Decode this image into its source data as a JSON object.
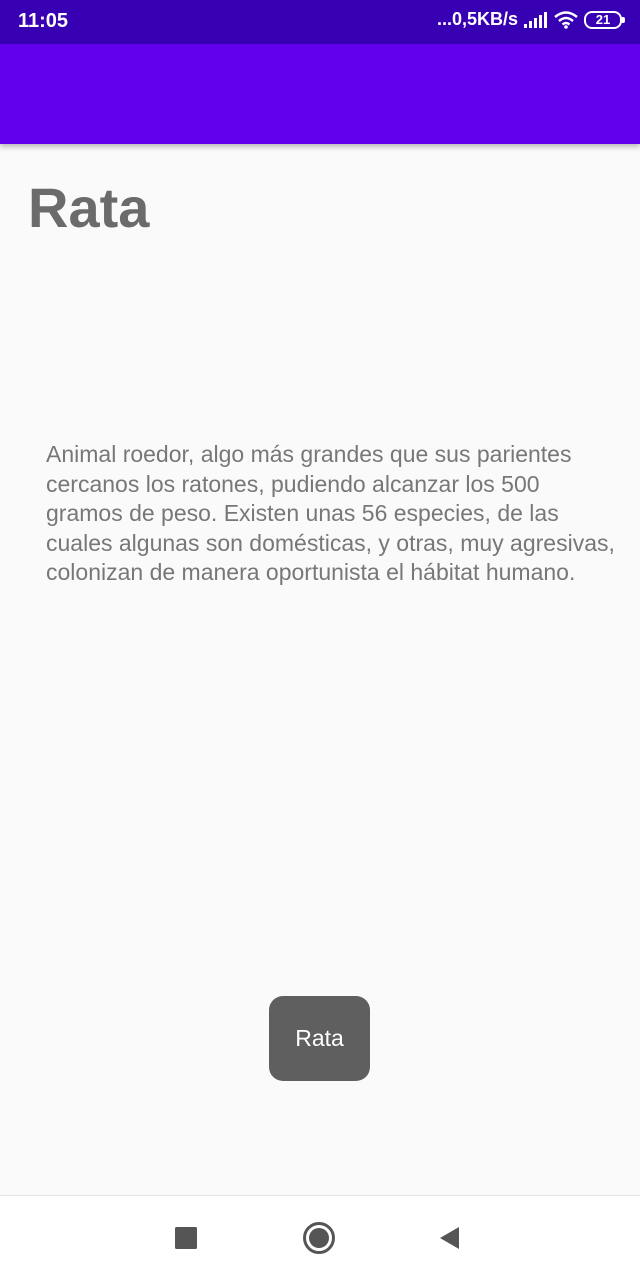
{
  "status_bar": {
    "time": "11:05",
    "network_speed": "...0,5KB/s",
    "battery_level": "21",
    "icons": [
      "signal-icon",
      "wifi-icon",
      "battery-icon"
    ]
  },
  "colors": {
    "status_bar": "#3700b3",
    "app_bar": "#6200ee",
    "background": "#fafafa",
    "title_text": "#6b6b6b",
    "body_text": "#777777",
    "toast": "#5f5f5f"
  },
  "main": {
    "title": "Rata",
    "description": "Animal roedor, algo más grandes que sus parientes cercanos los ratones, pudiendo alcanzar los 500 gramos de peso. Existen unas 56 especies, de las cuales algunas son domésticas, y otras, muy agresivas, colonizan de manera oportunista el hábitat humano."
  },
  "toast": {
    "text": "Rata"
  },
  "nav_bar": {
    "icons": [
      "recents-square-icon",
      "home-circle-icon",
      "back-triangle-icon"
    ]
  }
}
